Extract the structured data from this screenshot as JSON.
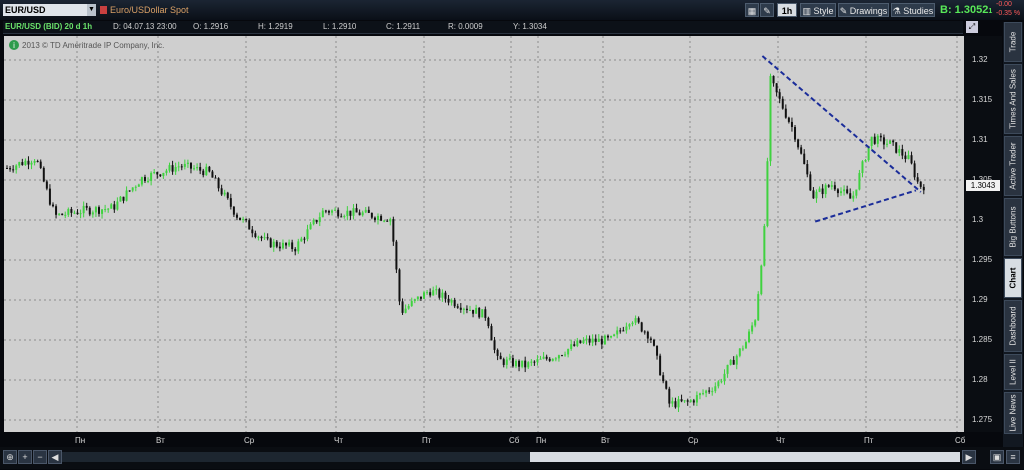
{
  "header": {
    "symbol": "EUR/USD",
    "description": "Euro/USDollar Spot",
    "timeframe": "1h",
    "style_label": "Style",
    "drawings_label": "Drawings",
    "studies_label": "Studies",
    "bid_label": "B: 1.3052",
    "bid_suffix": "1",
    "change_top": "-0.00",
    "change_bottom": "-0.35 %"
  },
  "infobar": {
    "series": "EUR/USD (BID) 20 d 1h",
    "date": "D: 04.07.13 23:00",
    "open": "O: 1.2916",
    "high": "H: 1.2919",
    "low": "L: 1.2910",
    "close": "C: 1.2911",
    "range": "R: 0.0009",
    "y": "Y: 1.3034",
    "copyright": "2013 © TD Ameritrade IP Company, Inc."
  },
  "yaxis": {
    "ticks": [
      "1.32",
      "1.315",
      "1.31",
      "1.305",
      "1.3",
      "1.295",
      "1.29",
      "1.285",
      "1.28",
      "1.275"
    ],
    "last_price": "1.3043"
  },
  "xaxis": {
    "ticks": [
      "Пн",
      "Вт",
      "Ср",
      "Чт",
      "Пт",
      "Сб",
      "Пн",
      "Вт",
      "Ср",
      "Чт",
      "Пт",
      "Сб"
    ]
  },
  "sidebar": {
    "tabs": [
      "Trade",
      "Times And Sales",
      "Active Trader",
      "Big Buttons",
      "Chart",
      "Dashboard",
      "Level II",
      "Live News"
    ]
  },
  "colors": {
    "up": "#3fd23f",
    "down": "#111111",
    "trendline": "#1b2d9a",
    "plot_bg": "#cfcfcf",
    "grid": "#8e8e8e"
  },
  "chart_data": {
    "type": "candlestick",
    "ylim": [
      1.2735,
      1.323
    ],
    "grid": true,
    "x": [
      "Пн",
      "Вт",
      "Ср",
      "Чт",
      "Пт",
      "Сб",
      "Пн",
      "Вт",
      "Ср",
      "Чт",
      "Пт",
      "Сб"
    ],
    "close_path": [
      [
        0,
        1.3065
      ],
      [
        0.03,
        1.3078
      ],
      [
        0.05,
        1.3005
      ],
      [
        0.08,
        1.3012
      ],
      [
        0.11,
        1.3015
      ],
      [
        0.14,
        1.3052
      ],
      [
        0.18,
        1.3068
      ],
      [
        0.21,
        1.306
      ],
      [
        0.24,
        1.3005
      ],
      [
        0.27,
        1.2972
      ],
      [
        0.3,
        1.2965
      ],
      [
        0.33,
        1.3012
      ],
      [
        0.37,
        1.3008
      ],
      [
        0.4,
        1.3002
      ],
      [
        0.41,
        1.2885
      ],
      [
        0.44,
        1.2912
      ],
      [
        0.47,
        1.2895
      ],
      [
        0.5,
        1.288
      ],
      [
        0.51,
        1.2825
      ],
      [
        0.54,
        1.2818
      ],
      [
        0.57,
        1.283
      ],
      [
        0.6,
        1.2848
      ],
      [
        0.63,
        1.285
      ],
      [
        0.65,
        1.2878
      ],
      [
        0.67,
        1.2855
      ],
      [
        0.69,
        1.277
      ],
      [
        0.71,
        1.2772
      ],
      [
        0.74,
        1.2795
      ],
      [
        0.77,
        1.2848
      ],
      [
        0.78,
        1.288
      ],
      [
        0.79,
        1.3
      ],
      [
        0.795,
        1.3175
      ],
      [
        0.82,
        1.311
      ],
      [
        0.84,
        1.303
      ],
      [
        0.86,
        1.3045
      ],
      [
        0.88,
        1.3025
      ],
      [
        0.9,
        1.3102
      ],
      [
        0.92,
        1.3095
      ],
      [
        0.94,
        1.3075
      ],
      [
        0.95,
        1.3043
      ]
    ],
    "trendlines": [
      {
        "from": [
          0.79,
          1.3205
        ],
        "to": [
          0.955,
          1.3035
        ]
      },
      {
        "from": [
          0.845,
          1.2998
        ],
        "to": [
          0.95,
          1.3037
        ]
      }
    ]
  }
}
